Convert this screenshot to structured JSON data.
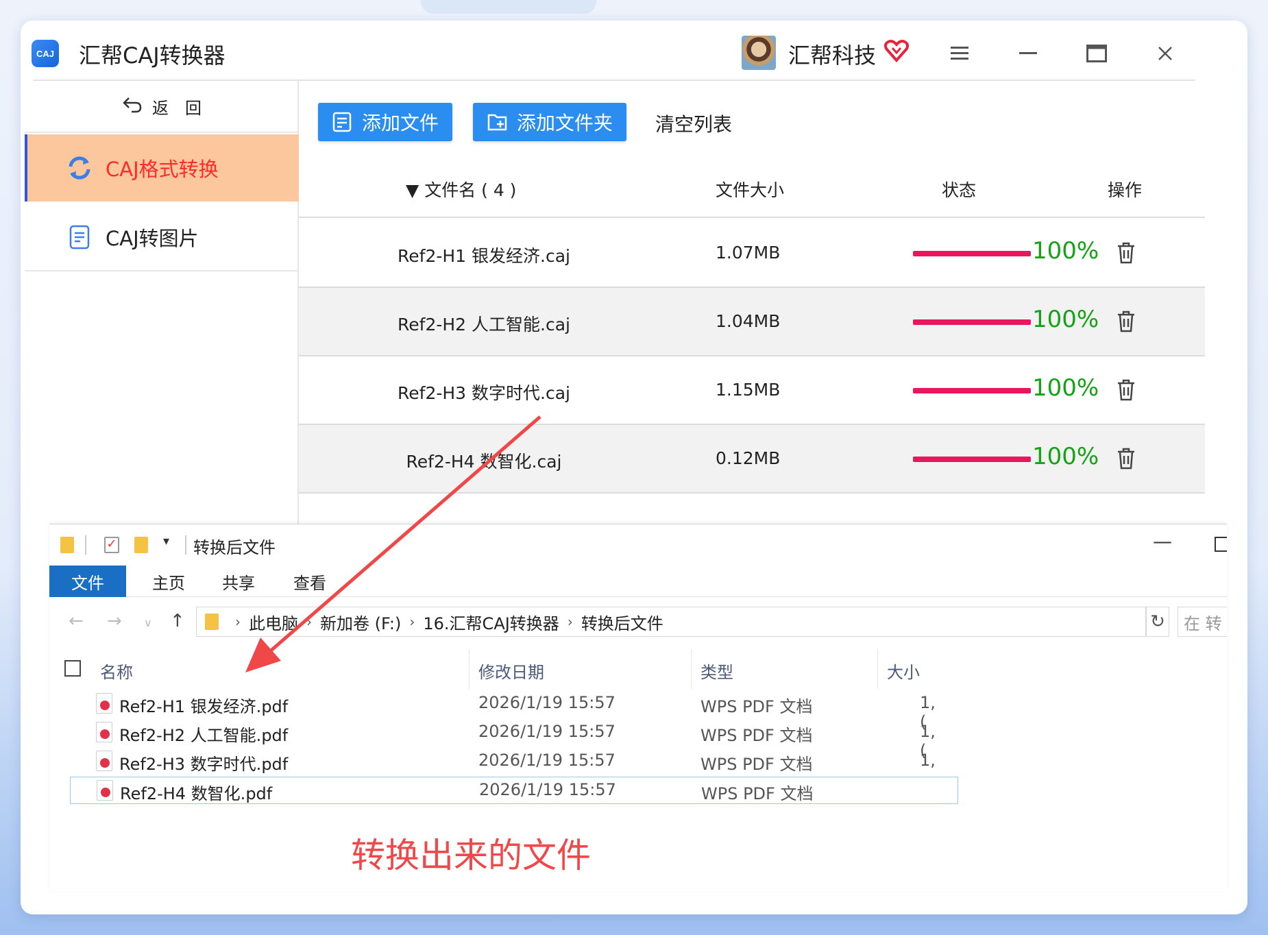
{
  "app": {
    "title": "汇帮CAJ转换器",
    "logo_text": "CAJ",
    "user_name": "汇帮科技"
  },
  "sidebar": {
    "back_label": "返　回",
    "items": [
      {
        "label": "CAJ格式转换",
        "active": true
      },
      {
        "label": "CAJ转图片",
        "active": false
      }
    ]
  },
  "toolbar": {
    "add_file": "添加文件",
    "add_folder": "添加文件夹",
    "clear_list": "清空列表"
  },
  "table": {
    "headers": {
      "name": "文件名 ( 4 )",
      "size": "文件大小",
      "status": "状态",
      "op": "操作"
    },
    "rows": [
      {
        "name": "Ref2-H1 银发经济.caj",
        "size": "1.07MB",
        "progress": 100,
        "progress_text": "100%"
      },
      {
        "name": "Ref2-H2 人工智能.caj",
        "size": "1.04MB",
        "progress": 100,
        "progress_text": "100%"
      },
      {
        "name": "Ref2-H3 数字时代.caj",
        "size": "1.15MB",
        "progress": 100,
        "progress_text": "100%"
      },
      {
        "name": "Ref2-H4 数智化.caj",
        "size": "0.12MB",
        "progress": 100,
        "progress_text": "100%"
      }
    ]
  },
  "explorer": {
    "title": "转换后文件",
    "ribbon_tabs": [
      "文件",
      "主页",
      "共享",
      "查看"
    ],
    "breadcrumb": [
      "此电脑",
      "新加卷 (F:)",
      "16.汇帮CAJ转换器",
      "转换后文件"
    ],
    "search_placeholder": "在 转",
    "columns": {
      "name": "名称",
      "date": "修改日期",
      "type": "类型",
      "size": "大小"
    },
    "files": [
      {
        "name": "Ref2-H1 银发经济.pdf",
        "date": "2026/1/19 15:57",
        "type": "WPS PDF 文档",
        "size": "1,("
      },
      {
        "name": "Ref2-H2 人工智能.pdf",
        "date": "2026/1/19 15:57",
        "type": "WPS PDF 文档",
        "size": "1,("
      },
      {
        "name": "Ref2-H3 数字时代.pdf",
        "date": "2026/1/19 15:57",
        "type": "WPS PDF 文档",
        "size": "1,"
      },
      {
        "name": "Ref2-H4 数智化.pdf",
        "date": "2026/1/19 15:57",
        "type": "WPS PDF 文档",
        "size": ""
      }
    ]
  },
  "annotation": "转换出来的文件",
  "colors": {
    "accent_blue": "#2b8df0",
    "active_bg": "#fcc79d",
    "active_text": "#ff2a2a",
    "progress_bar": "#e8175d",
    "progress_text": "#14a314",
    "annotation_red": "#f04848"
  }
}
